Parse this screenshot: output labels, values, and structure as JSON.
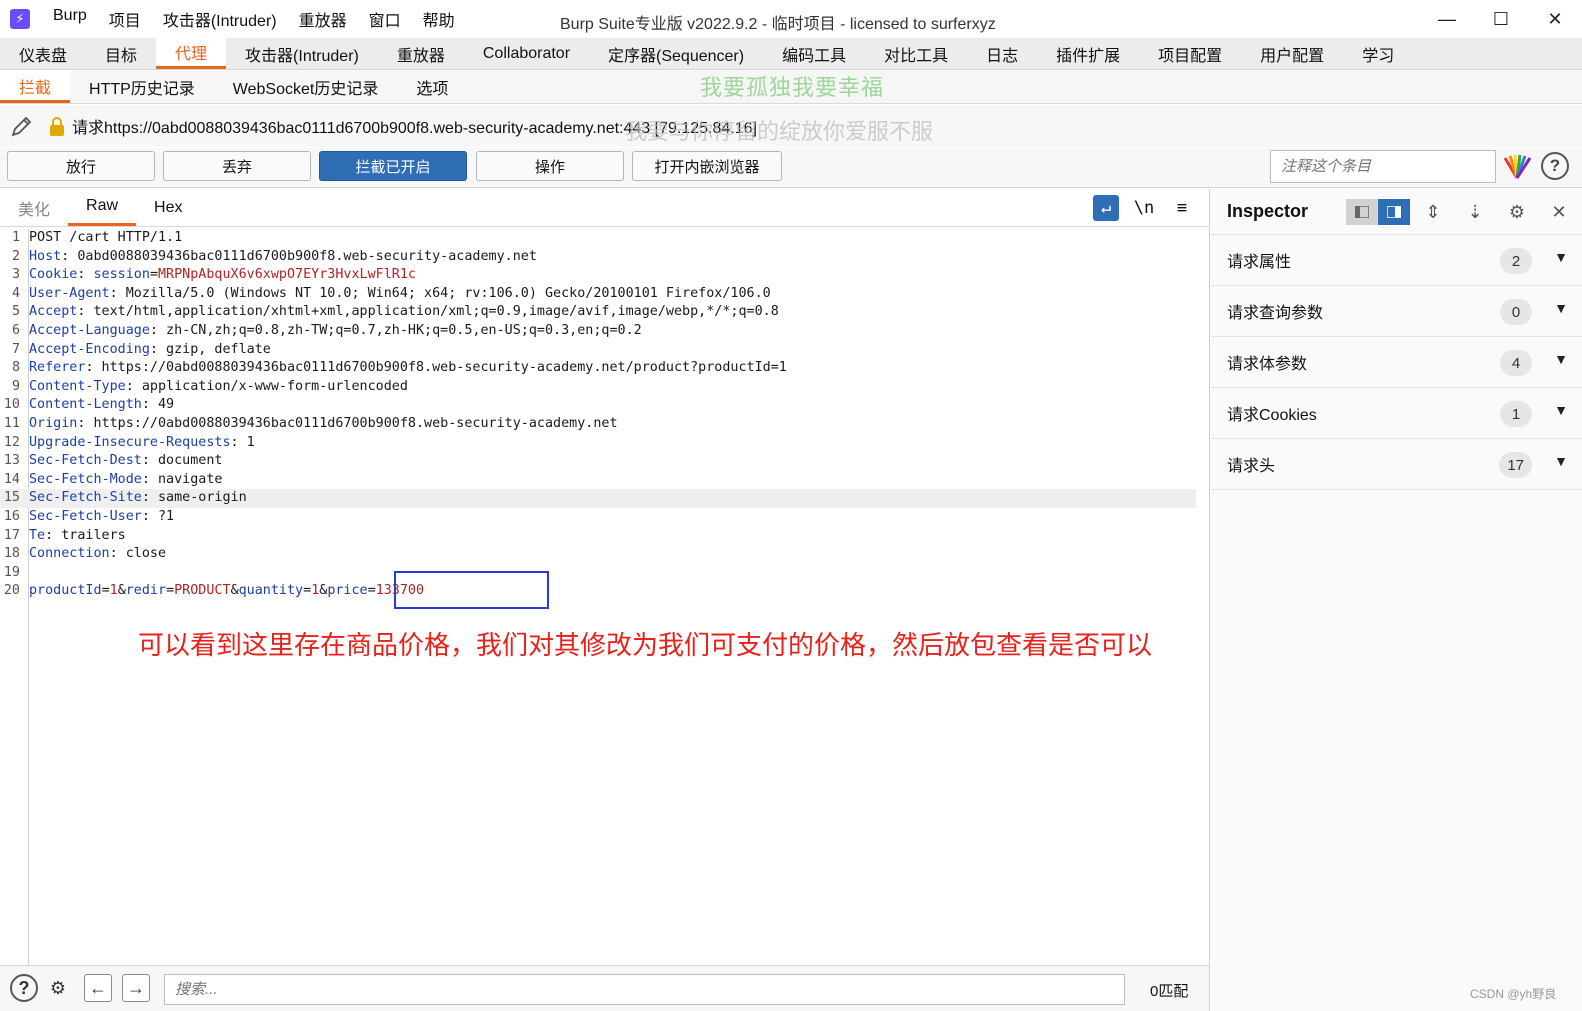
{
  "titlebar": {
    "menu": [
      "Burp",
      "项目",
      "攻击器(Intruder)",
      "重放器",
      "窗口",
      "帮助"
    ],
    "window_title": "Burp Suite专业版  v2022.9.2 - 临时项目 - licensed to surferxyz"
  },
  "main_tabs": [
    "仪表盘",
    "目标",
    "代理",
    "攻击器(Intruder)",
    "重放器",
    "Collaborator",
    "定序器(Sequencer)",
    "编码工具",
    "对比工具",
    "日志",
    "插件扩展",
    "项目配置",
    "用户配置",
    "学习"
  ],
  "sub_tabs": [
    "拦截",
    "HTTP历史记录",
    "WebSocket历史记录",
    "选项"
  ],
  "watermarks": [
    "我要孤独我要幸福",
    "我要与你停留的绽放你爱服不服"
  ],
  "request": {
    "url_label": "请求https://0abd0088039436bac0111d6700b900f8.web-security-academy.net:443 [79.125.84.16]"
  },
  "buttons": {
    "forward": "放行",
    "drop": "丢弃",
    "intercept": "拦截已开启",
    "action": "操作",
    "open_browser": "打开内嵌浏览器"
  },
  "note": {
    "placeholder": "注释这个条目"
  },
  "editor_tabs": [
    "美化",
    "Raw",
    "Hex"
  ],
  "editor_icons": {
    "newline": "\\n",
    "menu": "≡"
  },
  "request_lines": [
    {
      "n": "1",
      "key": "",
      "val": "POST /cart HTTP/1.1"
    },
    {
      "n": "2",
      "key": "Host",
      "val": " 0abd0088039436bac0111d6700b900f8.web-security-academy.net"
    },
    {
      "n": "3",
      "key": "Cookie",
      "cookie_name": " session=",
      "cookie_val": "MRPNpAbquX6v6xwpO7EYr3HvxLwFlR1c"
    },
    {
      "n": "4",
      "key": "User-Agent",
      "val": " Mozilla/5.0 (Windows NT 10.0; Win64; x64; rv:106.0) Gecko/20100101 Firefox/106.0"
    },
    {
      "n": "5",
      "key": "Accept",
      "val": " text/html,application/xhtml+xml,application/xml;q=0.9,image/avif,image/webp,*/*;q=0.8"
    },
    {
      "n": "6",
      "key": "Accept-Language",
      "val": " zh-CN,zh;q=0.8,zh-TW;q=0.7,zh-HK;q=0.5,en-US;q=0.3,en;q=0.2"
    },
    {
      "n": "7",
      "key": "Accept-Encoding",
      "val": " gzip, deflate"
    },
    {
      "n": "8",
      "key": "Referer",
      "val": " https://0abd0088039436bac0111d6700b900f8.web-security-academy.net/product?productId=1"
    },
    {
      "n": "9",
      "key": "Content-Type",
      "val": " application/x-www-form-urlencoded"
    },
    {
      "n": "10",
      "key": "Content-Length",
      "val": " 49"
    },
    {
      "n": "11",
      "key": "Origin",
      "val": " https://0abd0088039436bac0111d6700b900f8.web-security-academy.net"
    },
    {
      "n": "12",
      "key": "Upgrade-Insecure-Requests",
      "val": " 1"
    },
    {
      "n": "13",
      "key": "Sec-Fetch-Dest",
      "val": " document"
    },
    {
      "n": "14",
      "key": "Sec-Fetch-Mode",
      "val": " navigate"
    },
    {
      "n": "15",
      "key": "Sec-Fetch-Site",
      "val": " same-origin"
    },
    {
      "n": "16",
      "key": "Sec-Fetch-User",
      "val": " ?1"
    },
    {
      "n": "17",
      "key": "Te",
      "val": " trailers"
    },
    {
      "n": "18",
      "key": "Connection",
      "val": " close"
    },
    {
      "n": "19",
      "key": "",
      "val": ""
    }
  ],
  "body_line": {
    "n": "20",
    "params": [
      {
        "name": "productId",
        "value": "1"
      },
      {
        "name": "redir",
        "value": "PRODUCT"
      },
      {
        "name": "quantity",
        "value": "1"
      },
      {
        "name": "price",
        "value": "133700"
      }
    ]
  },
  "annotation": "可以看到这里存在商品价格，我们对其修改为我们可支付的价格，然后放包查看是否可以",
  "search": {
    "placeholder": "搜索...",
    "match_count": "0匹配"
  },
  "inspector": {
    "title": "Inspector",
    "sections": [
      {
        "label": "请求属性",
        "count": "2"
      },
      {
        "label": "请求查询参数",
        "count": "0"
      },
      {
        "label": "请求体参数",
        "count": "4"
      },
      {
        "label": "请求Cookies",
        "count": "1"
      },
      {
        "label": "请求头",
        "count": "17"
      }
    ]
  },
  "footer_watermark": "CSDN @yh野良",
  "colors": {
    "accent": "#e5661c",
    "primary": "#2f6db5",
    "annotation": "#e8211b",
    "box": "#2a3bd8"
  }
}
